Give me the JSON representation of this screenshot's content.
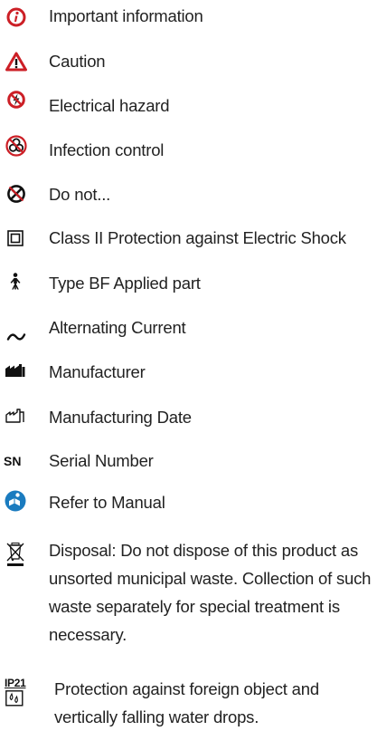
{
  "colors": {
    "red": "#cc1f26",
    "black": "#111111",
    "blue": "#1a7bbf",
    "text": "#222222"
  },
  "symbols": [
    {
      "icon": "important-information-icon",
      "label": "Important information"
    },
    {
      "icon": "caution-triangle-icon",
      "label": "Caution"
    },
    {
      "icon": "electrical-hazard-icon",
      "label": "Electrical hazard"
    },
    {
      "icon": "biohazard-icon",
      "label": "Infection control"
    },
    {
      "icon": "do-not-icon",
      "label": "Do not..."
    },
    {
      "icon": "double-square-icon",
      "label": "Class II Protection against Electric Shock"
    },
    {
      "icon": "type-bf-person-icon",
      "label": "Type BF Applied part"
    },
    {
      "icon": "alternating-current-icon",
      "label": "Alternating Current"
    },
    {
      "icon": "factory-icon",
      "label": "Manufacturer"
    },
    {
      "icon": "manufacturing-date-icon",
      "label": "Manufacturing Date"
    },
    {
      "icon": "serial-number-icon",
      "label": "Serial Number",
      "icon_text": "SN"
    },
    {
      "icon": "manual-book-icon",
      "label": "Refer to Manual"
    },
    {
      "icon": "crossed-bin-icon",
      "label": "Disposal: Do not dispose of this product as unsorted municipal waste. Collection of such waste separately for special treatment is necessary."
    },
    {
      "icon": "ip21-icon",
      "label": "Protection against foreign object and vertically falling water drops.",
      "icon_text": "IP21"
    }
  ]
}
